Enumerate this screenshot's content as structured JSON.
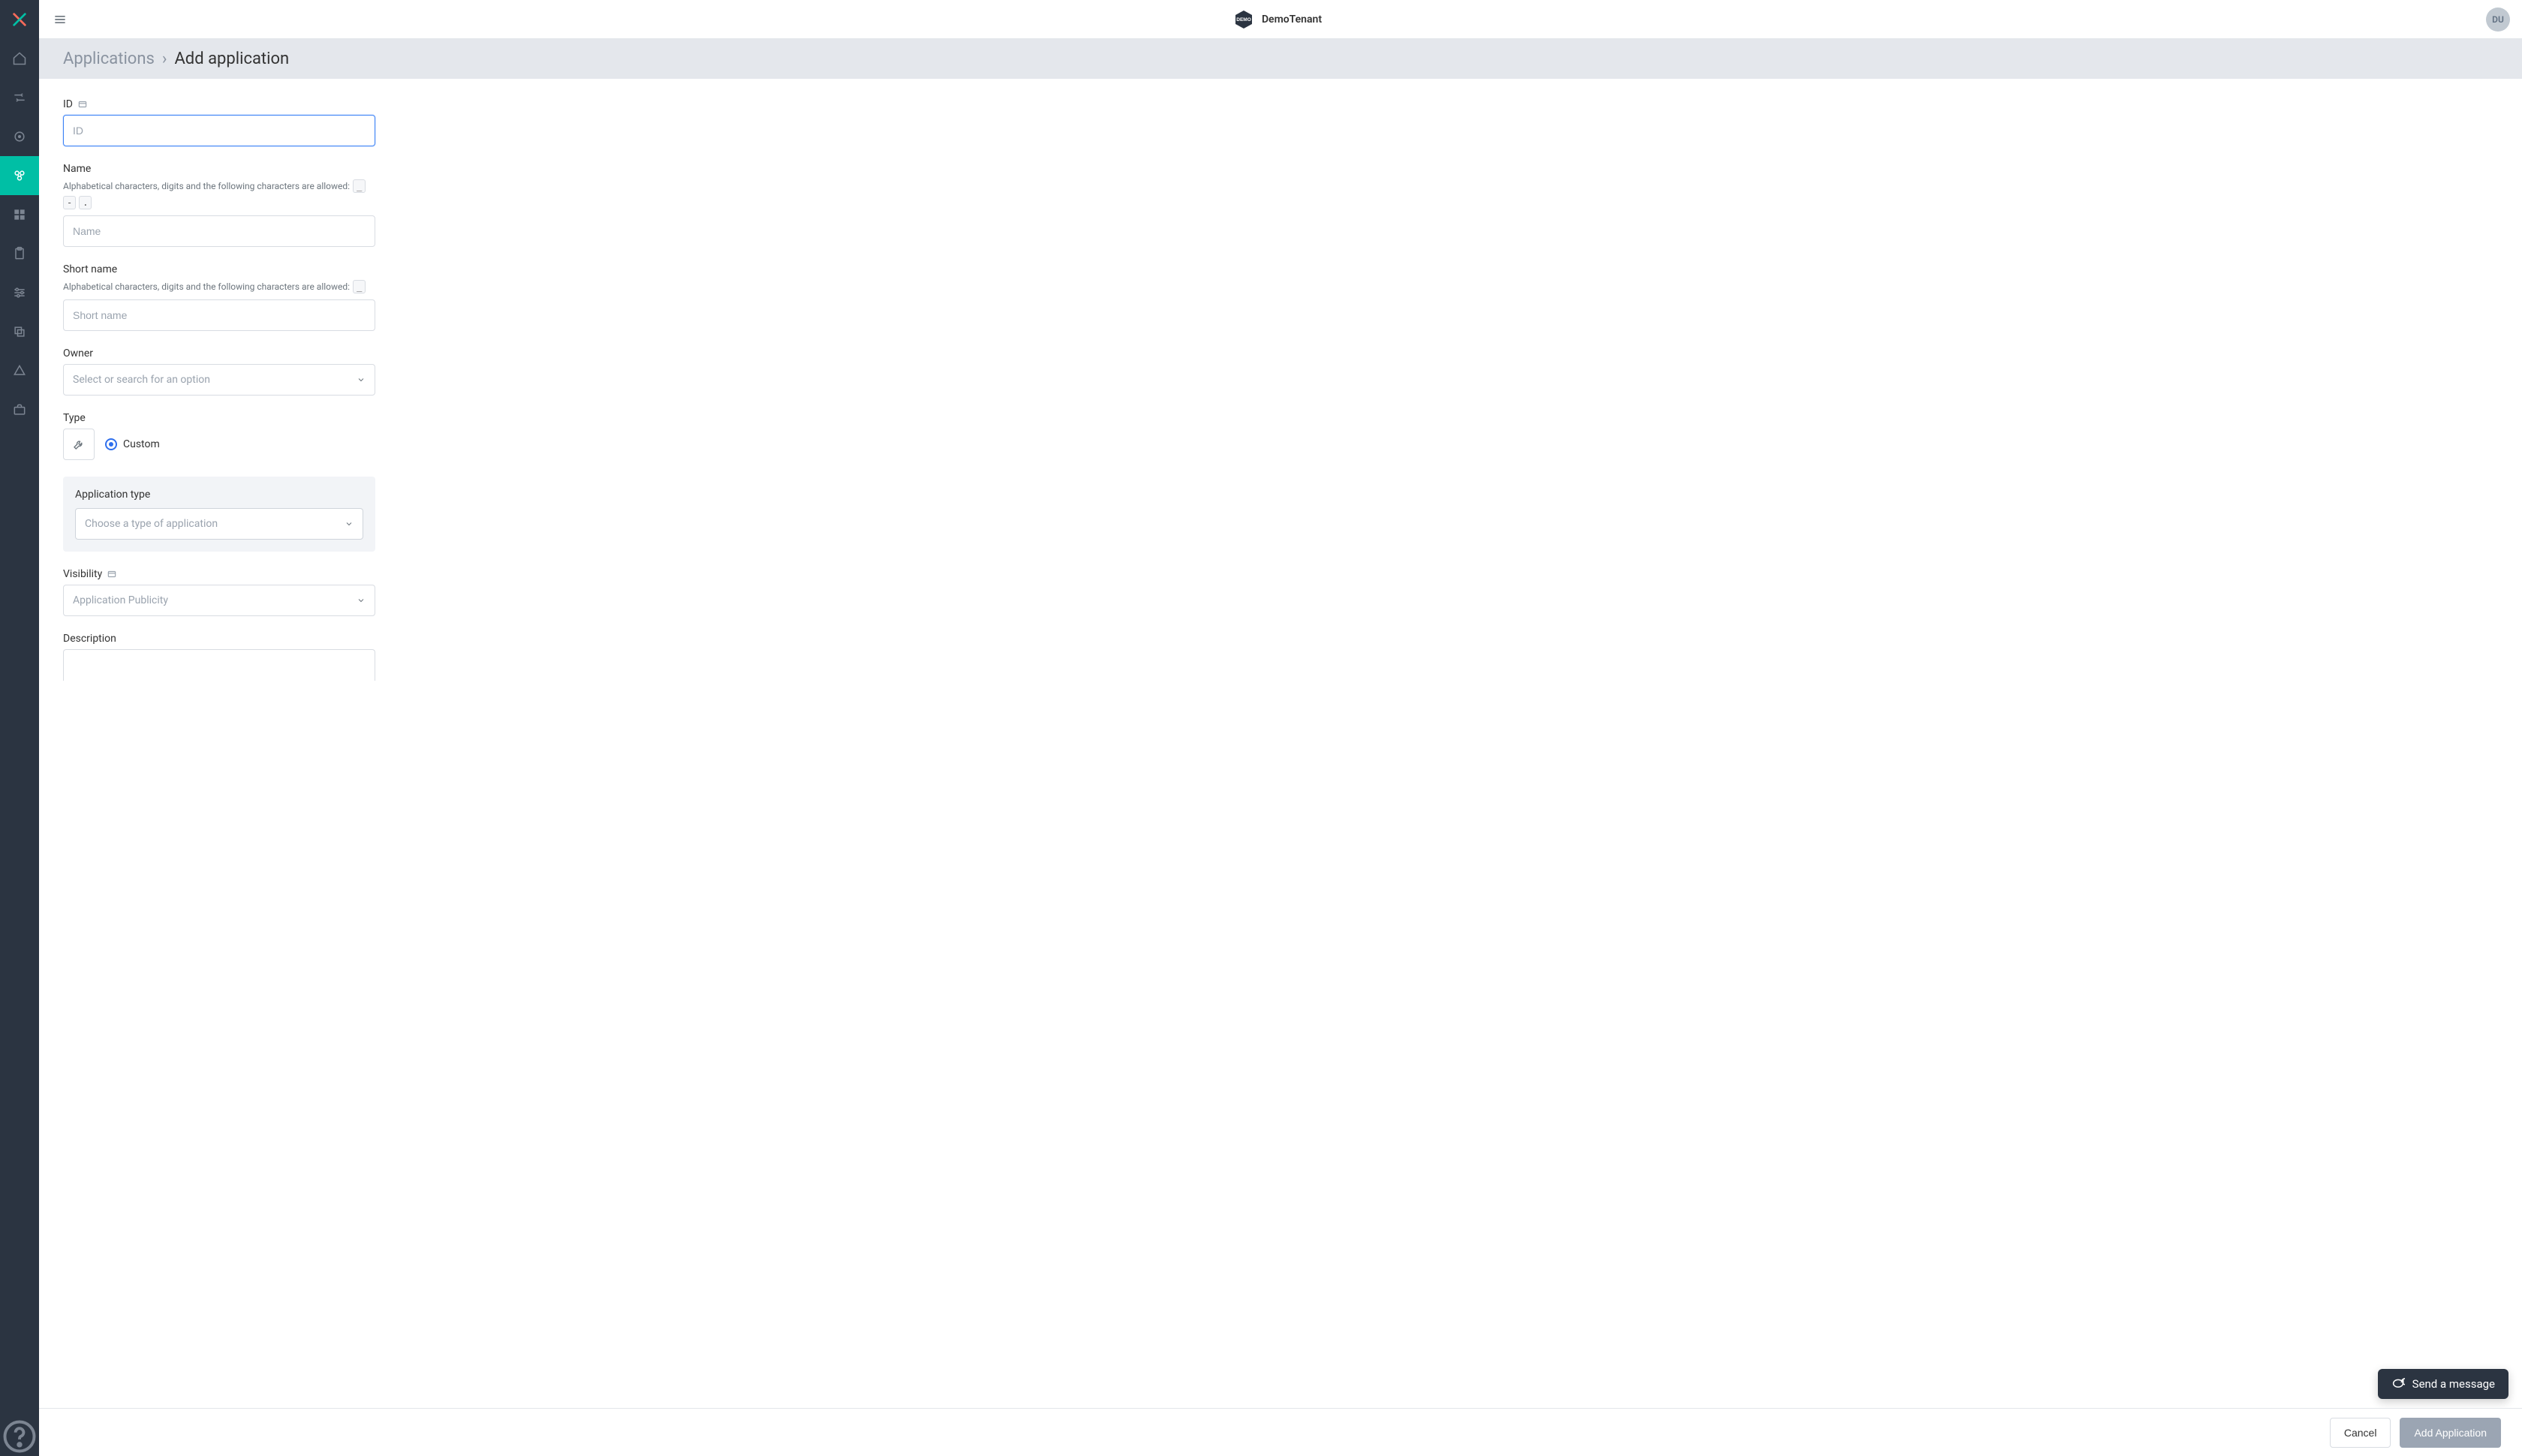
{
  "header": {
    "tenant_name": "DemoTenant",
    "avatar_initials": "DU"
  },
  "breadcrumb": {
    "root": "Applications",
    "separator": "›",
    "current": "Add application"
  },
  "form": {
    "id": {
      "label": "ID",
      "placeholder": "ID",
      "value": ""
    },
    "name": {
      "label": "Name",
      "hint": "Alphabetical characters, digits and the following characters are allowed:",
      "allowed_chars": [
        "_",
        "-",
        "."
      ],
      "placeholder": "Name",
      "value": ""
    },
    "short_name": {
      "label": "Short name",
      "hint": "Alphabetical characters, digits and the following characters are allowed:",
      "allowed_chars": [
        "_"
      ],
      "placeholder": "Short name",
      "value": ""
    },
    "owner": {
      "label": "Owner",
      "placeholder": "Select or search for an option"
    },
    "type": {
      "label": "Type",
      "option_label": "Custom",
      "selected": true
    },
    "app_type": {
      "label": "Application type",
      "placeholder": "Choose a type of application"
    },
    "visibility": {
      "label": "Visibility",
      "placeholder": "Application Publicity"
    },
    "description": {
      "label": "Description"
    }
  },
  "footer": {
    "cancel": "Cancel",
    "submit": "Add Application"
  },
  "chat": {
    "label": "Send a message"
  }
}
